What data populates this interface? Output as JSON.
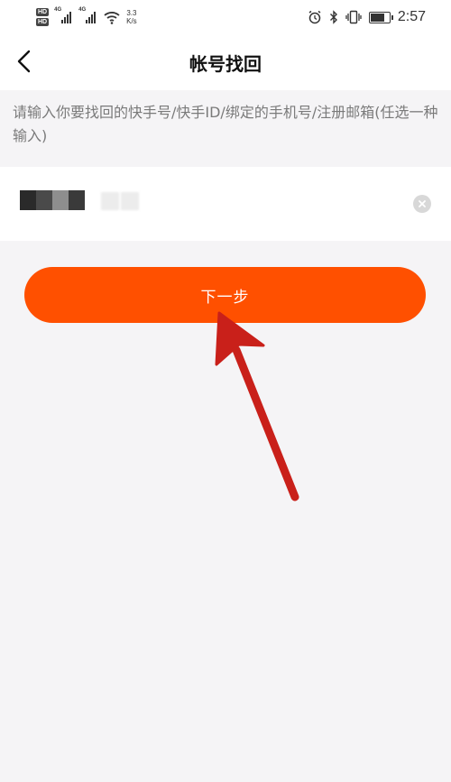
{
  "status_bar": {
    "network_speed": "3.3",
    "network_speed_unit": "K/s",
    "network_type_1": "4G",
    "network_type_2": "4G",
    "hd_label_1": "HD",
    "hd_label_2": "HD",
    "time": "2:57",
    "battery_level": 0.75,
    "icons": [
      "alarm-icon",
      "bluetooth-icon",
      "vibrate-icon",
      "battery-icon"
    ]
  },
  "navbar": {
    "title": "帐号找回",
    "back_icon": "chevron-left-icon"
  },
  "hint": "请输入你要找回的快手号/快手ID/绑定的手机号/注册邮箱(任选一种输入)",
  "input": {
    "value_obscured": true,
    "clear_icon": "clear-icon"
  },
  "next_button": {
    "label": "下一步"
  },
  "annotation": {
    "type": "arrow",
    "color": "#c9201a"
  },
  "colors": {
    "accent": "#ff5000",
    "background": "#f5f4f6",
    "hint_text": "#7a7a7a"
  }
}
